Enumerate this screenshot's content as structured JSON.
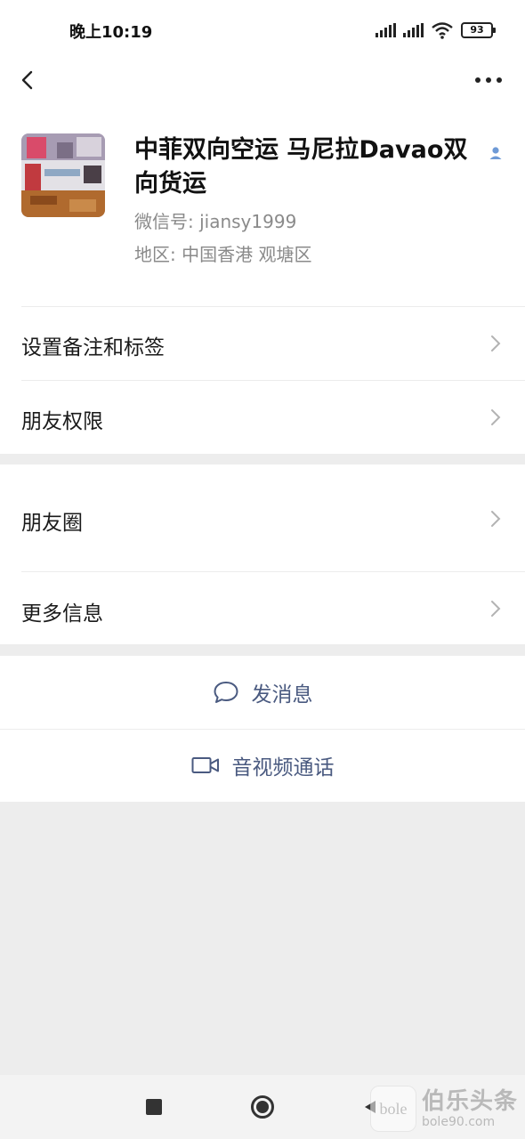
{
  "status_bar": {
    "time": "晚上10:19",
    "battery": "93"
  },
  "nav": {
    "back_icon": "chevron-left-icon",
    "more_icon": "ellipsis-icon"
  },
  "profile": {
    "name": "中菲双向空运 马尼拉Davao双向货运",
    "wechat_id": "微信号: jiansy1999",
    "region": "地区: 中国香港  观塘区",
    "verify_icon": "person-icon",
    "verify_color": "#6e9ad6"
  },
  "settings": [
    {
      "label": "设置备注和标签"
    },
    {
      "label": "朋友权限"
    }
  ],
  "info": [
    {
      "label": "朋友圈"
    },
    {
      "label": "更多信息"
    }
  ],
  "actions": {
    "message": {
      "label": "发消息",
      "icon": "chat-bubble-icon"
    },
    "call": {
      "label": "音视频通话",
      "icon": "video-camera-icon"
    },
    "color": "#4a5a80"
  },
  "system_nav": {
    "recent_icon": "square-icon",
    "home_icon": "circle-icon",
    "back_icon": "triangle-back-icon"
  },
  "watermark": {
    "logo_text": "bole",
    "title": "伯乐头条",
    "subtitle": "bole90.com"
  }
}
